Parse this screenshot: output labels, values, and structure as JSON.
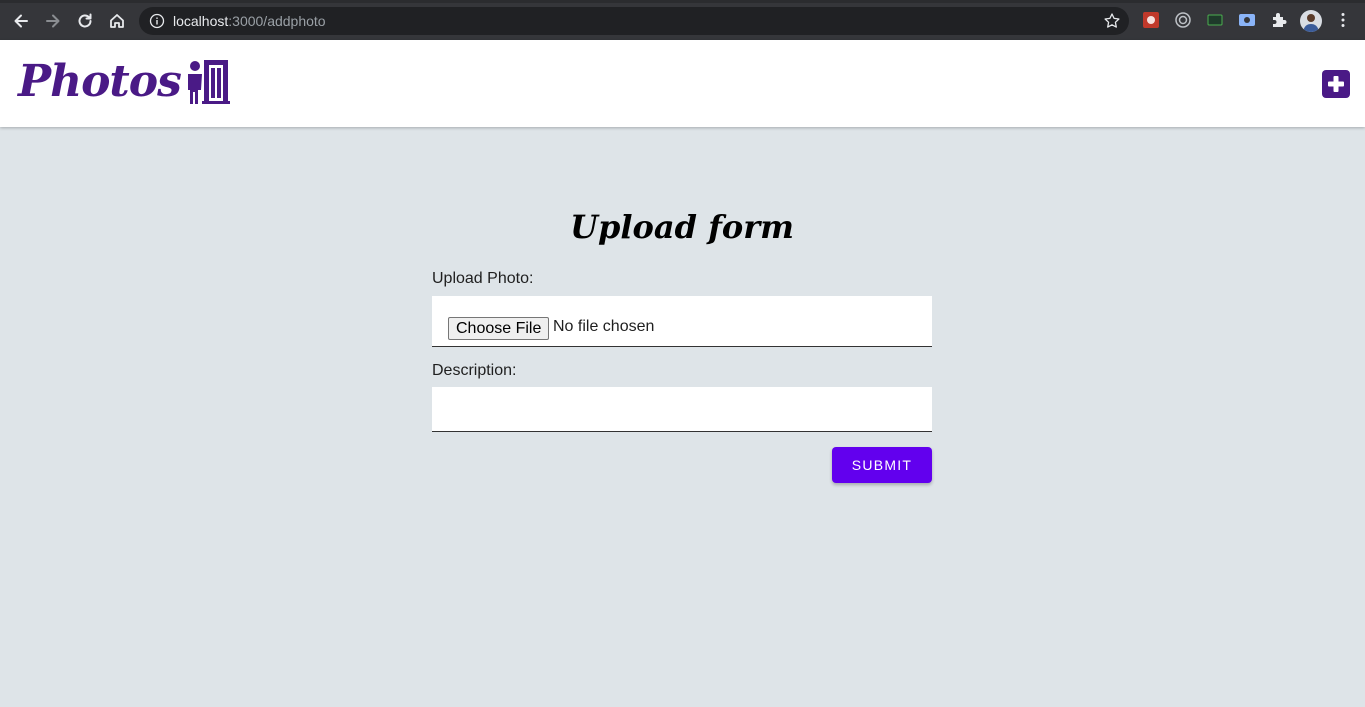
{
  "browser": {
    "url_host": "localhost",
    "url_path": ":3000/addphoto"
  },
  "header": {
    "logo_text": "Photos",
    "brand_color": "#4a1a86"
  },
  "form": {
    "title": "Upload form",
    "photo_label": "Upload Photo:",
    "choose_file_label": "Choose File",
    "no_file_text": "No file chosen",
    "description_label": "Description:",
    "description_value": "",
    "submit_label": "SUBMIT",
    "submit_color": "#6200ee"
  }
}
